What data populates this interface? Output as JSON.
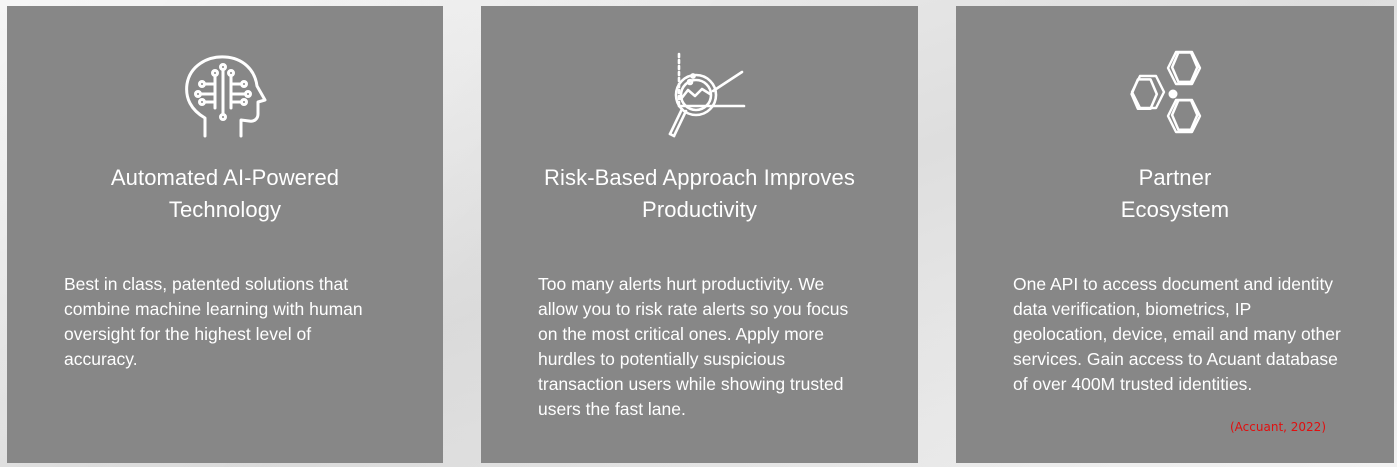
{
  "cards": [
    {
      "icon": "ai-brain-icon",
      "title_lines": [
        "Automated AI-Powered",
        "Technology"
      ],
      "body_lines": [
        "Best in class, patented solutions that",
        "combine machine learning with human",
        "oversight for the highest level of",
        "accuracy."
      ]
    },
    {
      "icon": "magnifier-chart-icon",
      "title_lines": [
        "Risk-Based Approach Improves",
        "Productivity"
      ],
      "body_lines": [
        "Too many alerts hurt productivity. We",
        "allow you to risk rate alerts so you focus",
        "on the most critical ones. Apply more",
        "hurdles to potentially suspicious",
        "transaction users while showing trusted",
        "users the fast lane."
      ]
    },
    {
      "icon": "hexagon-network-icon",
      "title_lines": [
        "Partner",
        "Ecosystem"
      ],
      "body_lines": [
        "One API to access document and identity",
        "data verification, biometrics, IP",
        "geolocation, device, email and many other",
        "services. Gain access to Acuant database",
        "of over 400M trusted identities."
      ],
      "citation": "(Accuant, 2022)",
      "citation_color": "#e01010"
    }
  ],
  "colors": {
    "card_background": "#878787",
    "text": "#ffffff"
  }
}
